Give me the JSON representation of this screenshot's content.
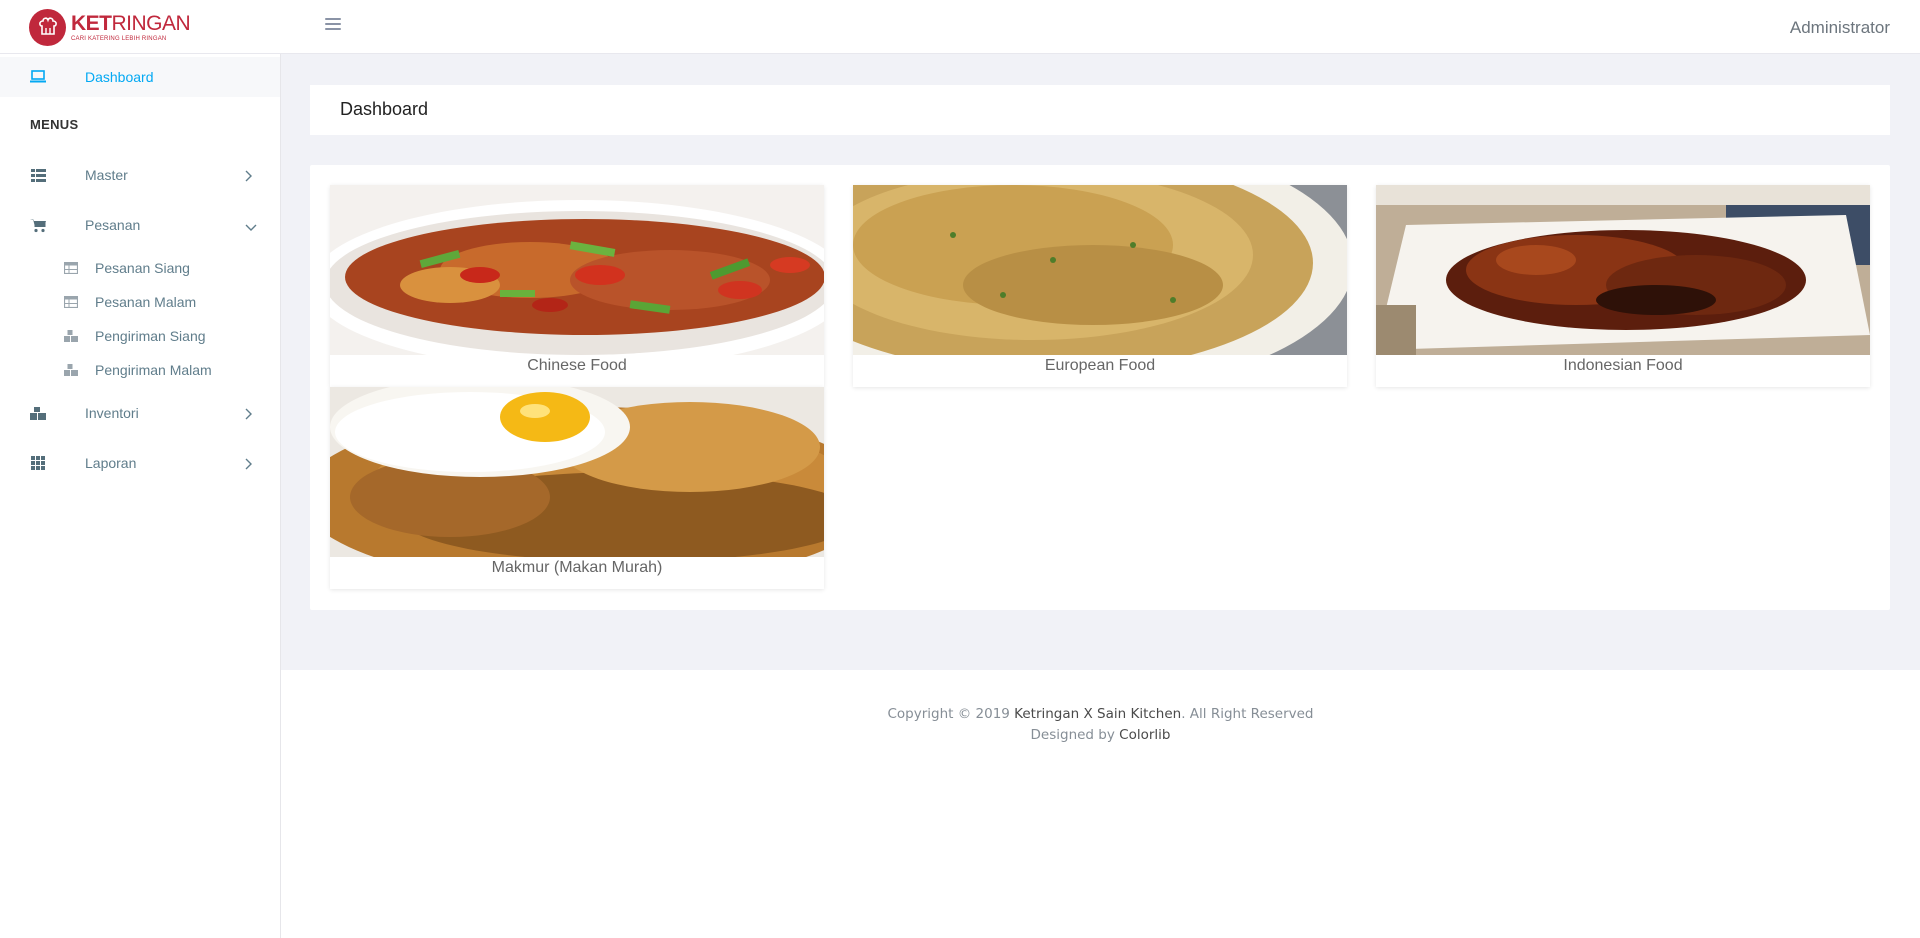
{
  "header": {
    "logo_bold": "KET",
    "logo_light": "RINGAN",
    "logo_tagline": "CARI KATERING LEBIH RINGAN",
    "user": "Administrator"
  },
  "sidebar": {
    "dashboard": "Dashboard",
    "heading": "MENUS",
    "items": [
      {
        "label": "Master",
        "icon": "list-icon"
      },
      {
        "label": "Pesanan",
        "icon": "cart-icon"
      },
      {
        "label": "Inventori",
        "icon": "boxes-icon"
      },
      {
        "label": "Laporan",
        "icon": "grid-icon"
      }
    ],
    "pesanan_sub": [
      {
        "label": "Pesanan Siang",
        "icon": "table-icon"
      },
      {
        "label": "Pesanan Malam",
        "icon": "table-icon"
      },
      {
        "label": "Pengiriman Siang",
        "icon": "boxes-icon"
      },
      {
        "label": "Pengiriman Malam",
        "icon": "boxes-icon"
      }
    ]
  },
  "main": {
    "title": "Dashboard",
    "foods": [
      {
        "name": "Chinese Food"
      },
      {
        "name": "European Food"
      },
      {
        "name": "Indonesian Food"
      },
      {
        "name": "Makmur (Makan Murah)"
      }
    ]
  },
  "footer": {
    "copyright_prefix": "Copyright © 2019 ",
    "brand": "Ketringan X Sain Kitchen",
    "copyright_suffix": ". All Right Reserved",
    "designed_prefix": "Designed by ",
    "designer": "Colorlib"
  },
  "colors": {
    "brand": "#c0283c",
    "accent": "#03a9f3",
    "sidebar_text": "#607d8b",
    "page_bg": "#f1f2f7"
  }
}
